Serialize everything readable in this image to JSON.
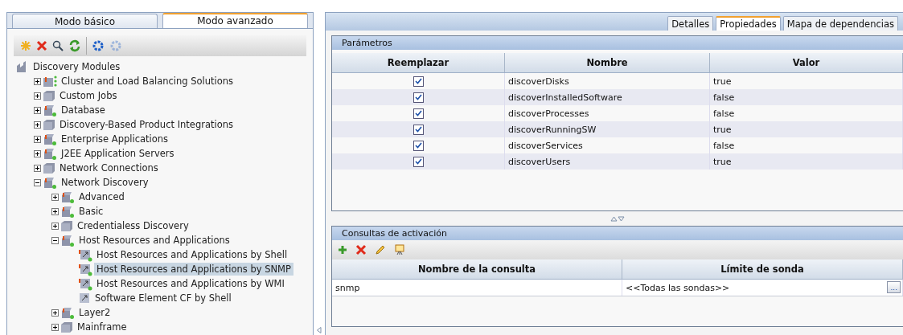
{
  "mode_tabs": [
    {
      "label": "Modo básico",
      "selected": false
    },
    {
      "label": "Modo avanzado",
      "selected": true
    }
  ],
  "toolbar": [
    {
      "kind": "new",
      "disabled": false
    },
    {
      "kind": "delete",
      "disabled": false
    },
    {
      "kind": "find",
      "disabled": false
    },
    {
      "kind": "refresh",
      "disabled": false
    },
    {
      "kind": "sep"
    },
    {
      "kind": "gear",
      "disabled": false
    },
    {
      "kind": "gear",
      "disabled": true
    }
  ],
  "tree": {
    "label": "Discovery Modules",
    "kind": "root",
    "selected": false,
    "children": [
      {
        "label": "Cluster and Load Balancing Solutions",
        "kind": "cluster",
        "expanded": false,
        "selected": false
      },
      {
        "label": "Custom Jobs",
        "kind": "folder",
        "expanded": false,
        "selected": false
      },
      {
        "label": "Database",
        "kind": "module",
        "expanded": false,
        "selected": false
      },
      {
        "label": "Discovery-Based Product Integrations",
        "kind": "folder",
        "expanded": false,
        "selected": false
      },
      {
        "label": "Enterprise Applications",
        "kind": "module",
        "expanded": false,
        "selected": false
      },
      {
        "label": "J2EE Application Servers",
        "kind": "module",
        "expanded": false,
        "selected": false
      },
      {
        "label": "Network Connections",
        "kind": "folder",
        "expanded": false,
        "selected": false
      },
      {
        "label": "Network Discovery",
        "kind": "module",
        "expanded": true,
        "selected": false,
        "children": [
          {
            "label": "Advanced",
            "kind": "module",
            "expanded": false,
            "selected": false
          },
          {
            "label": "Basic",
            "kind": "module",
            "expanded": false,
            "selected": false
          },
          {
            "label": "Credentialess Discovery",
            "kind": "folder",
            "expanded": false,
            "selected": false
          },
          {
            "label": "Host Resources and Applications",
            "kind": "module",
            "expanded": true,
            "selected": false,
            "children": [
              {
                "label": "Host Resources and Applications by Shell",
                "kind": "job-active",
                "selected": false
              },
              {
                "label": "Host Resources and Applications by SNMP",
                "kind": "job-active",
                "selected": true
              },
              {
                "label": "Host Resources and Applications by WMI",
                "kind": "job-active",
                "selected": false
              },
              {
                "label": "Software Element CF by Shell",
                "kind": "job",
                "selected": false
              }
            ]
          },
          {
            "label": "Layer2",
            "kind": "module",
            "expanded": false,
            "selected": false
          },
          {
            "label": "Mainframe",
            "kind": "folder",
            "expanded": false,
            "selected": false
          }
        ]
      }
    ]
  },
  "detail_tabs": [
    {
      "label": "Detalles",
      "selected": false
    },
    {
      "label": "Propiedades",
      "selected": true
    },
    {
      "label": "Mapa de dependencias",
      "selected": false
    }
  ],
  "parameters": {
    "title": "Parámetros",
    "columns": [
      "Reemplazar",
      "Nombre",
      "Valor"
    ],
    "rows": [
      {
        "override": true,
        "name": "discoverDisks",
        "value": "true"
      },
      {
        "override": true,
        "name": "discoverInstalledSoftware",
        "value": "false"
      },
      {
        "override": true,
        "name": "discoverProcesses",
        "value": "false"
      },
      {
        "override": true,
        "name": "discoverRunningSW",
        "value": "true"
      },
      {
        "override": true,
        "name": "discoverServices",
        "value": "false"
      },
      {
        "override": true,
        "name": "discoverUsers",
        "value": "true"
      }
    ]
  },
  "triggers": {
    "title": "Consultas de activación",
    "toolbar": [
      {
        "kind": "add"
      },
      {
        "kind": "delete"
      },
      {
        "kind": "edit"
      },
      {
        "kind": "preview"
      }
    ],
    "columns": [
      "Nombre de la consulta",
      "Límite de sonda"
    ],
    "rows": [
      {
        "query": "snmp",
        "probe": "<<Todas las sondas>>",
        "browse": "..."
      }
    ]
  }
}
